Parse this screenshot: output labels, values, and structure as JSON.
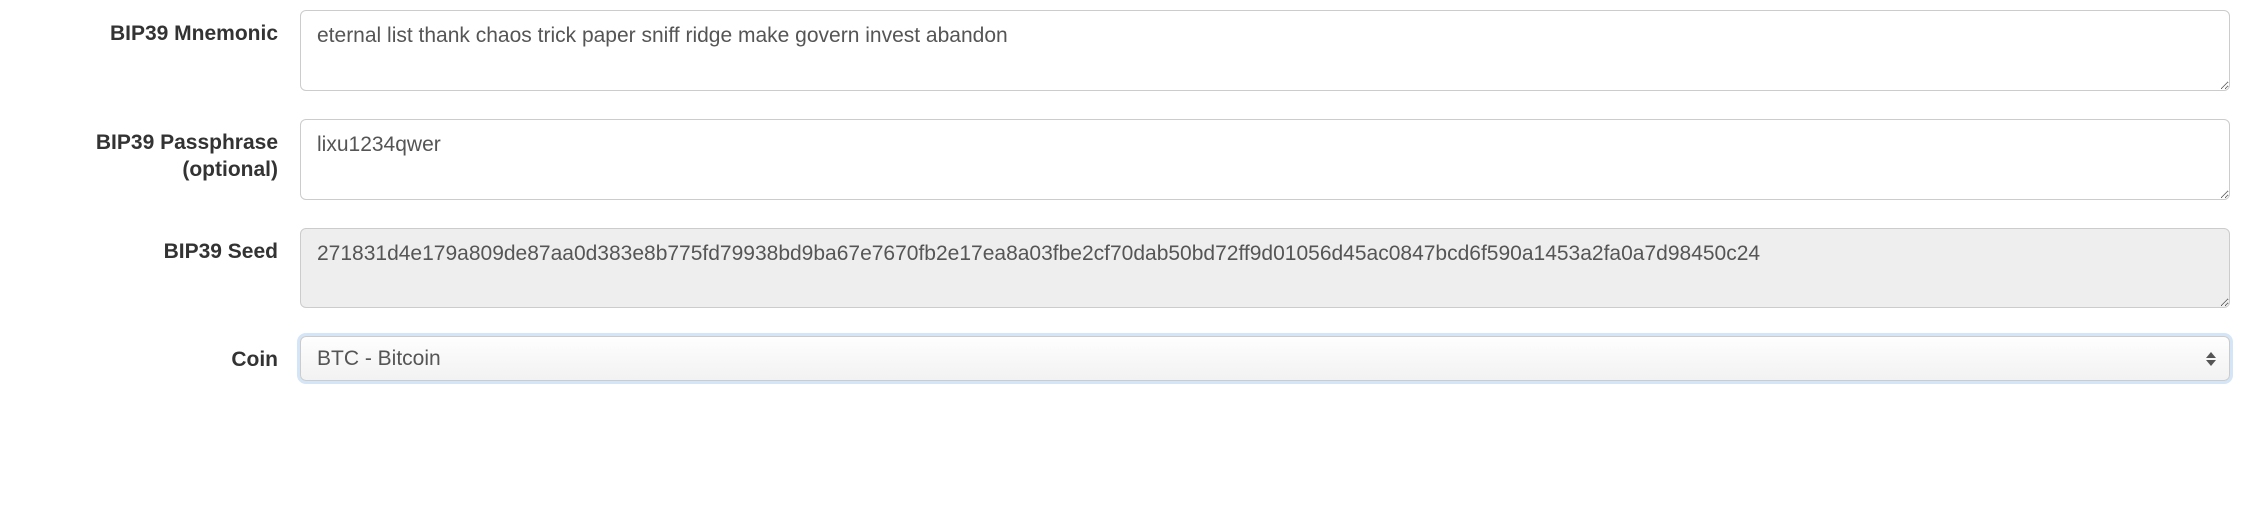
{
  "fields": {
    "mnemonic": {
      "label": "BIP39 Mnemonic",
      "value": "eternal list thank chaos trick paper sniff ridge make govern invest abandon"
    },
    "passphrase": {
      "label": "BIP39 Passphrase (optional)",
      "value": "lixu1234qwer"
    },
    "seed": {
      "label": "BIP39 Seed",
      "value": "271831d4e179a809de87aa0d383e8b775fd79938bd9ba67e7670fb2e17ea8a03fbe2cf70dab50bd72ff9d01056d45ac0847bcd6f590a1453a2fa0a7d98450c24"
    },
    "coin": {
      "label": "Coin",
      "selected": "BTC - Bitcoin"
    }
  }
}
